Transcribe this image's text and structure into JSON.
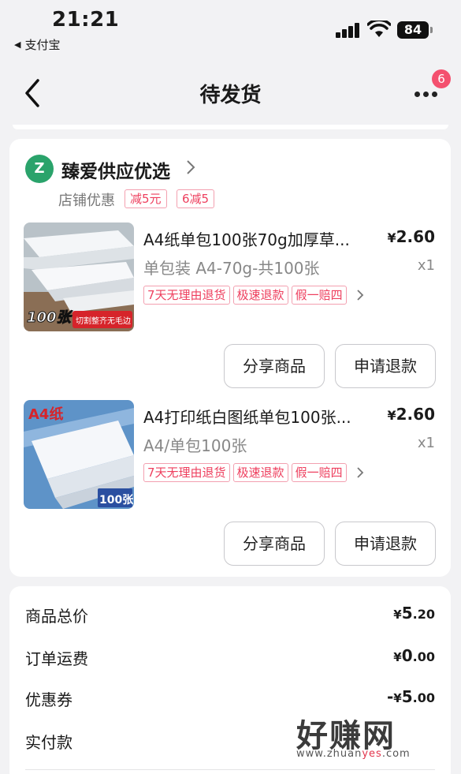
{
  "status_bar": {
    "time": "21:21",
    "back_app": "支付宝",
    "battery": "84"
  },
  "nav": {
    "title": "待发货",
    "more_badge": "6"
  },
  "shop": {
    "logo_text": "Z",
    "name": "臻爱供应优选",
    "promo_label": "店铺优惠",
    "promo_tags": [
      "减5元",
      "6减5"
    ]
  },
  "items": [
    {
      "title": "A4纸单包100张70g加厚草...",
      "price_symbol": "¥",
      "price": "2.60",
      "spec": "单包装 A4-70g-共100张",
      "qty": "x1",
      "service_tags": [
        "7天无理由退货",
        "极速退款",
        "假一赔四"
      ],
      "thumb_caption": "100张",
      "thumb_banner": "切割整齐无毛边",
      "share_label": "分享商品",
      "refund_label": "申请退款"
    },
    {
      "title": "A4打印纸白图纸单包100张...",
      "price_symbol": "¥",
      "price": "2.60",
      "spec": "A4/单包100张",
      "qty": "x1",
      "service_tags": [
        "7天无理由退货",
        "极速退款",
        "假一赔四"
      ],
      "thumb_caption": "A4纸",
      "thumb_count": "100张",
      "share_label": "分享商品",
      "refund_label": "申请退款"
    }
  ],
  "summary": {
    "rows": [
      {
        "label": "商品总价",
        "prefix": "",
        "symbol": "¥",
        "int": "5",
        "dec": ".20"
      },
      {
        "label": "订单运费",
        "prefix": "",
        "symbol": "¥",
        "int": "0",
        "dec": ".00"
      },
      {
        "label": "优惠券",
        "prefix": "-",
        "symbol": "¥",
        "int": "5",
        "dec": ".00"
      },
      {
        "label": "实付款"
      }
    ]
  },
  "watermark": {
    "main": "好赚网",
    "sub_pre": "www.zhuan",
    "sub_hl": "yes",
    "sub_post": ".com"
  },
  "colors": {
    "accent": "#ee3f5e",
    "shop_logo": "#2aa36b",
    "badge": "#f4506e"
  }
}
